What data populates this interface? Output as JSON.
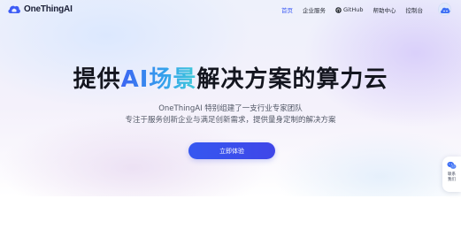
{
  "brand": {
    "name": "OneThingAI"
  },
  "nav": {
    "items": [
      {
        "label": "首页",
        "active": true
      },
      {
        "label": "企业服务",
        "active": false
      },
      {
        "label": "GitHub",
        "active": false
      },
      {
        "label": "帮助中心",
        "active": false
      },
      {
        "label": "控制台",
        "active": false
      }
    ]
  },
  "hero": {
    "title_prefix": "提供",
    "title_accent": "AI场景",
    "title_suffix": "解决方案的算力云",
    "subtitle_line1": "OneThingAI 特别组建了一支行业专家团队",
    "subtitle_line2": "专注于服务创新企业与满足创新需求，提供量身定制的解决方案",
    "cta_label": "立即体验"
  },
  "float_contact": {
    "label": "联系我们",
    "icon": "wechat-icon"
  },
  "colors": {
    "accent": "#3d5cf5",
    "cta_start": "#3557f0",
    "cta_end": "#3f46e8",
    "title_gradient_start": "#3c66f2",
    "title_gradient_end": "#3fc9d8",
    "text_dark": "#14161f"
  }
}
